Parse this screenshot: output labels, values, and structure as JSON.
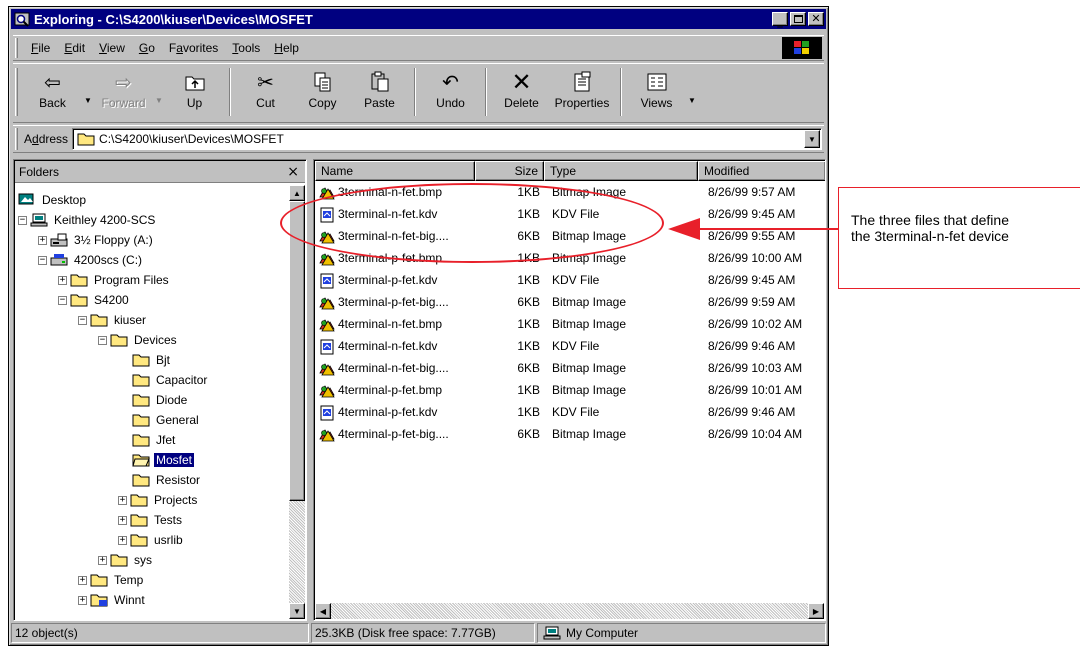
{
  "window": {
    "title": "Exploring - C:\\S4200\\kiuser\\Devices\\MOSFET",
    "caption_buttons": [
      "minimize",
      "maximize",
      "close"
    ]
  },
  "menu": [
    {
      "label": "File",
      "key": "F"
    },
    {
      "label": "Edit",
      "key": "E"
    },
    {
      "label": "View",
      "key": "V"
    },
    {
      "label": "Go",
      "key": "G"
    },
    {
      "label": "Favorites",
      "key": "a"
    },
    {
      "label": "Tools",
      "key": "T"
    },
    {
      "label": "Help",
      "key": "H"
    }
  ],
  "toolbar": {
    "back": "Back",
    "forward": "Forward",
    "up": "Up",
    "cut": "Cut",
    "copy": "Copy",
    "paste": "Paste",
    "undo": "Undo",
    "delete": "Delete",
    "properties": "Properties",
    "views": "Views"
  },
  "address": {
    "label": "Address",
    "value": "C:\\S4200\\kiuser\\Devices\\MOSFET"
  },
  "folders": {
    "title": "Folders",
    "close": "×",
    "tree": [
      {
        "label": "Desktop",
        "icon": "desktop-icon"
      },
      {
        "label": "Keithley 4200-SCS",
        "icon": "computer-icon",
        "expander": "−"
      },
      {
        "label": "3½ Floppy (A:)",
        "icon": "floppy-icon",
        "expander": "+"
      },
      {
        "label": "4200scs (C:)",
        "icon": "drive-icon",
        "expander": "−"
      },
      {
        "label": "Program Files",
        "icon": "folder-icon",
        "expander": "+"
      },
      {
        "label": "S4200",
        "icon": "folder-icon",
        "expander": "−"
      },
      {
        "label": "kiuser",
        "icon": "folder-icon",
        "expander": "−"
      },
      {
        "label": "Devices",
        "icon": "folder-open-icon",
        "expander": "−"
      },
      {
        "label": "Bjt",
        "icon": "folder-icon"
      },
      {
        "label": "Capacitor",
        "icon": "folder-icon"
      },
      {
        "label": "Diode",
        "icon": "folder-icon"
      },
      {
        "label": "General",
        "icon": "folder-icon"
      },
      {
        "label": "Jfet",
        "icon": "folder-icon"
      },
      {
        "label": "Mosfet",
        "icon": "folder-open-icon",
        "selected": true
      },
      {
        "label": "Resistor",
        "icon": "folder-icon"
      },
      {
        "label": "Projects",
        "icon": "folder-icon",
        "expander": "+"
      },
      {
        "label": "Tests",
        "icon": "folder-icon",
        "expander": "+"
      },
      {
        "label": "usrlib",
        "icon": "folder-icon",
        "expander": "+"
      },
      {
        "label": "sys",
        "icon": "folder-icon",
        "expander": "+"
      },
      {
        "label": "Temp",
        "icon": "folder-icon",
        "expander": "+"
      },
      {
        "label": "Winnt",
        "icon": "folder-icon",
        "expander": "+"
      }
    ]
  },
  "files": {
    "columns": [
      "Name",
      "Size",
      "Type",
      "Modified"
    ],
    "rows": [
      {
        "name": "3terminal-n-fet.bmp",
        "size": "1KB",
        "type": "Bitmap Image",
        "modified": "8/26/99 9:57 AM",
        "icon": "bitmap-icon"
      },
      {
        "name": "3terminal-n-fet.kdv",
        "size": "1KB",
        "type": "KDV File",
        "modified": "8/26/99 9:45 AM",
        "icon": "kdv-file-icon"
      },
      {
        "name": "3terminal-n-fet-big....",
        "size": "6KB",
        "type": "Bitmap Image",
        "modified": "8/26/99 9:55 AM",
        "icon": "bitmap-icon"
      },
      {
        "name": "3terminal-p-fet.bmp",
        "size": "1KB",
        "type": "Bitmap Image",
        "modified": "8/26/99 10:00 AM",
        "icon": "bitmap-icon"
      },
      {
        "name": "3terminal-p-fet.kdv",
        "size": "1KB",
        "type": "KDV File",
        "modified": "8/26/99 9:45 AM",
        "icon": "kdv-file-icon"
      },
      {
        "name": "3terminal-p-fet-big....",
        "size": "6KB",
        "type": "Bitmap Image",
        "modified": "8/26/99 9:59 AM",
        "icon": "bitmap-icon"
      },
      {
        "name": "4terminal-n-fet.bmp",
        "size": "1KB",
        "type": "Bitmap Image",
        "modified": "8/26/99 10:02 AM",
        "icon": "bitmap-icon"
      },
      {
        "name": "4terminal-n-fet.kdv",
        "size": "1KB",
        "type": "KDV File",
        "modified": "8/26/99 9:46 AM",
        "icon": "kdv-file-icon"
      },
      {
        "name": "4terminal-n-fet-big....",
        "size": "6KB",
        "type": "Bitmap Image",
        "modified": "8/26/99 10:03 AM",
        "icon": "bitmap-icon"
      },
      {
        "name": "4terminal-p-fet.bmp",
        "size": "1KB",
        "type": "Bitmap Image",
        "modified": "8/26/99 10:01 AM",
        "icon": "bitmap-icon"
      },
      {
        "name": "4terminal-p-fet.kdv",
        "size": "1KB",
        "type": "KDV File",
        "modified": "8/26/99 9:46 AM",
        "icon": "kdv-file-icon"
      },
      {
        "name": "4terminal-p-fet-big....",
        "size": "6KB",
        "type": "Bitmap Image",
        "modified": "8/26/99 10:04 AM",
        "icon": "bitmap-icon"
      }
    ]
  },
  "status": {
    "objects": "12 object(s)",
    "disk": "25.3KB (Disk free space: 7.77GB)",
    "zone": "My Computer"
  },
  "annotation": {
    "line1": "The three files that define",
    "line2": "the 3terminal-n-fet device",
    "color": "#e8202a"
  }
}
